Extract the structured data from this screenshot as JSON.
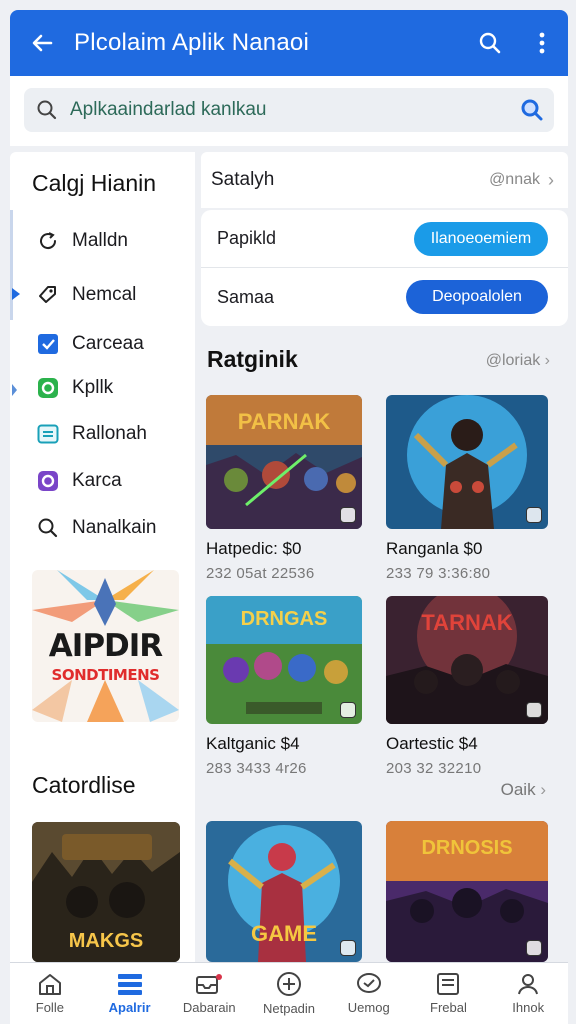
{
  "appbar": {
    "title": "Plcolaim Aplik Nanaoi"
  },
  "search": {
    "value": "Aplkaaindarlad kanlkau"
  },
  "sidebar": {
    "heading": "Calgj Hianin",
    "items": [
      {
        "label": "Malldn",
        "icon": "refresh-icon"
      },
      {
        "label": "Nemcal",
        "icon": "tag-icon"
      },
      {
        "label": "Carceaa",
        "icon": "check-box-icon"
      },
      {
        "label": "Kpllk",
        "icon": "green-app-icon"
      },
      {
        "label": "Rallonah",
        "icon": "list-icon"
      },
      {
        "label": "Karca",
        "icon": "purple-app-icon"
      },
      {
        "label": "Nanalkain",
        "icon": "search-icon"
      }
    ],
    "promo": {
      "line1": "AIPDIR",
      "line2": "SONDTIMENS"
    },
    "section2": "Catordlise",
    "side_game_title": "MAKGS"
  },
  "main": {
    "row1": {
      "title": "Satalyh",
      "more": "@nnak"
    },
    "options": [
      {
        "label": "Papikld",
        "button": "Ilanoeoemiem"
      },
      {
        "label": "Samaa",
        "button": "Deopoalolen"
      }
    ],
    "section": {
      "title": "Ratginik",
      "more": "@loriak"
    },
    "games": [
      {
        "name": "Hatpedic: $0",
        "meta": "232 05at 22536",
        "art": "PARNAK"
      },
      {
        "name": "Ranganla $0",
        "meta": "233 79 3:36:80",
        "art": ""
      },
      {
        "name": "Kaltganic $4",
        "meta": "283 3433 4r26",
        "art": "DRNGAS"
      },
      {
        "name": "Oartestic $4",
        "meta": "203 32 32210",
        "art": "TARNAK"
      },
      {
        "name": "",
        "meta": "",
        "art": "GAME"
      },
      {
        "name": "",
        "meta": "",
        "art": "DRNOSIS"
      }
    ],
    "more_link": "Oaik"
  },
  "tabs": [
    {
      "label": "Folle",
      "icon": "home-icon",
      "active": false
    },
    {
      "label": "Apalrir",
      "icon": "apps-icon",
      "active": true
    },
    {
      "label": "Dabarain",
      "icon": "inbox-icon",
      "active": false
    },
    {
      "label": "Netpadin",
      "icon": "plus-circle-icon",
      "active": false
    },
    {
      "label": "Uemog",
      "icon": "chat-icon",
      "active": false
    },
    {
      "label": "Frebal",
      "icon": "card-icon",
      "active": false
    },
    {
      "label": "Ihnok",
      "icon": "profile-icon",
      "active": false
    }
  ],
  "colors": {
    "primary": "#1f6ae0",
    "pill_light": "#1a9be8",
    "pill_dark": "#1c63d8"
  }
}
